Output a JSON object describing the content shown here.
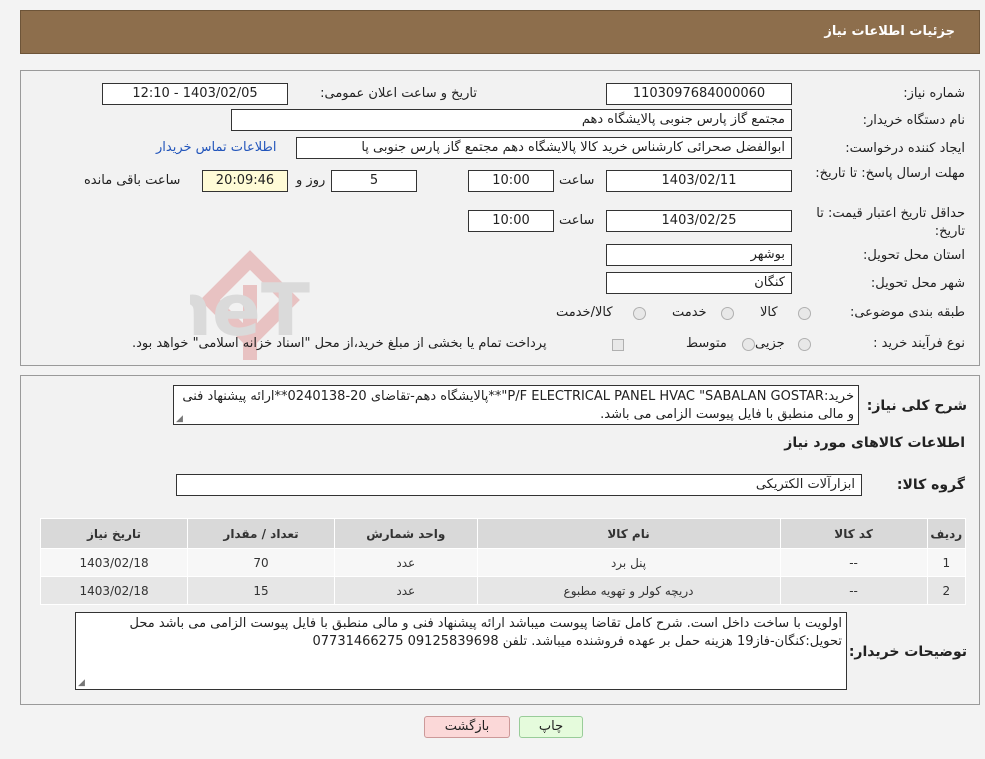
{
  "header": {
    "title": "جزئیات اطلاعات نیاز"
  },
  "form": {
    "need_number_label": "شماره نیاز:",
    "need_number": "1103097684000060",
    "announce_label": "تاریخ و ساعت اعلان عمومی:",
    "announce_value": "1403/02/05 - 12:10",
    "buyer_org_label": "نام دستگاه خریدار:",
    "buyer_org": "مجتمع گاز پارس جنوبی  پالایشگاه دهم",
    "creator_label": "ایجاد کننده درخواست:",
    "creator": "ابوالفضل صحرائی کارشناس خرید کالا پالایشگاه دهم مجتمع گاز پارس جنوبی  پا",
    "contact_link": "اطلاعات تماس خریدار",
    "deadline_label": "مهلت ارسال پاسخ: تا تاریخ:",
    "deadline_date": "1403/02/11",
    "time_label": "ساعت",
    "deadline_time": "10:00",
    "days_value": "5",
    "days_label": "روز و",
    "remaining_time": "20:09:46",
    "remaining_label": "ساعت باقی مانده",
    "validity_label": "حداقل تاریخ اعتبار قیمت: تا تاریخ:",
    "validity_date": "1403/02/25",
    "validity_time": "10:00",
    "province_label": "استان محل تحویل:",
    "province": "بوشهر",
    "city_label": "شهر محل تحویل:",
    "city": "کنگان",
    "category_label": "طبقه بندی موضوعی:",
    "category_options": [
      "کالا",
      "خدمت",
      "کالا/خدمت"
    ],
    "process_label": "نوع فرآیند خرید :",
    "process_options": [
      "جزیی",
      "متوسط"
    ],
    "process_note": "پرداخت تمام یا بخشی از مبلغ خرید،از محل \"اسناد خزانه اسلامی\" خواهد بود."
  },
  "summary": {
    "label": "شرح کلی نیاز:",
    "text": "خرید:P/F ELECTRICAL PANEL HVAC \"SABALAN GOSTAR\"**پالایشگاه دهم-تقاضای 20-0240138**ارائه پیشنهاد فنی و مالی منطبق با فایل پیوست الزامی می باشد.",
    "goods_info_title": "اطلاعات کالاهای مورد نیاز",
    "group_label": "گروه کالا:",
    "group_value": "ابزارآلات الکتریکی"
  },
  "table": {
    "headers": [
      "ردیف",
      "کد کالا",
      "نام کالا",
      "واحد شمارش",
      "تعداد / مقدار",
      "تاریخ نیاز"
    ],
    "rows": [
      [
        "1",
        "--",
        "پنل برد",
        "عدد",
        "70",
        "1403/02/18"
      ],
      [
        "2",
        "--",
        "دریچه کولر و تهویه مطبوع",
        "عدد",
        "15",
        "1403/02/18"
      ]
    ]
  },
  "notes": {
    "label": "توضیحات خریدار:",
    "text": "اولویت با ساخت داخل است. شرح کامل تقاضا پیوست میباشد ارائه پیشنهاد فنی و مالی منطبق با فایل پیوست الزامی می باشد        محل تحویل:کنگان-فاز19 هزینه حمل بر عهده فروشنده میباشد. تلفن 09125839698  07731466275"
  },
  "buttons": {
    "print": "چاپ",
    "back": "بازگشت"
  },
  "watermark": {
    "text": "AriaTender.neT"
  },
  "colors": {
    "header": "#8d6e4c",
    "link": "#2255bb",
    "back_btn": "#fbd8d8",
    "print_btn": "#e5fbdc"
  }
}
